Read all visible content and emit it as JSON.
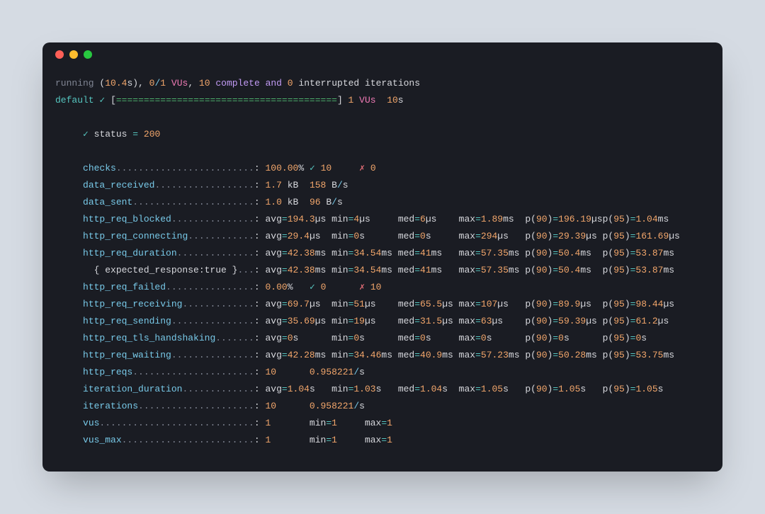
{
  "header": {
    "word_running": "running",
    "elapsed": "10.4",
    "vus_cur": "0",
    "vus_max": "1",
    "word_VUs": "VUs",
    "iters_done": "10",
    "word_complete": "complete",
    "word_and": "and",
    "interrupted": "0",
    "tail": " interrupted iterations"
  },
  "progress": {
    "label_default": "default",
    "check": "✓",
    "bar": "========================================",
    "vus_num": "1",
    "vus_word": "VUs",
    "dur": "10",
    "dur_unit": "s"
  },
  "status_check": {
    "mark": "✓",
    "text": "status",
    "eq": "=",
    "code": "200"
  },
  "metrics": {
    "checks": {
      "name": "checks",
      "dots": ".........................",
      "pct": "100.00",
      "pct_sym": "%",
      "check_n": "10",
      "fail_n": "0"
    },
    "data_received": {
      "name": "data_received",
      "dots": "..................",
      "val": "1.7",
      "unit": "kB",
      "rate": "158",
      "rate_unit_pre": "B",
      "rate_slash": "/",
      "rate_unit_post": "s"
    },
    "data_sent": {
      "name": "data_sent",
      "dots": "......................",
      "val": "1.0",
      "unit": "kB",
      "rate": "96",
      "rate_unit_pre": "B",
      "rate_slash": "/",
      "rate_unit_post": "s"
    },
    "http_req_blocked": {
      "name": "http_req_blocked",
      "dots": "...............",
      "avg": "194.3µs",
      "min": "4µs",
      "med": "6µs",
      "max": "1.89ms",
      "p90": "196.19µs",
      "p95": "1.04ms"
    },
    "http_req_connecting": {
      "name": "http_req_connecting",
      "dots": "............",
      "avg": "29.4µs",
      "min": "0s",
      "med": "0s",
      "max": "294µs",
      "p90": "29.39µs",
      "p95": "161.69µs"
    },
    "http_req_duration": {
      "name": "http_req_duration",
      "dots": "..............",
      "avg": "42.38ms",
      "min": "34.54ms",
      "med": "41ms",
      "max": "57.35ms",
      "p90": "50.4ms",
      "p95": "53.87ms"
    },
    "expected_response": {
      "label": "{ expected_response:true }",
      "dots": "...",
      "avg": "42.38ms",
      "min": "34.54ms",
      "med": "41ms",
      "max": "57.35ms",
      "p90": "50.4ms",
      "p95": "53.87ms"
    },
    "http_req_failed": {
      "name": "http_req_failed",
      "dots": "................",
      "pct": "0.00",
      "pct_sym": "%",
      "check_n": "0",
      "fail_n": "10"
    },
    "http_req_receiving": {
      "name": "http_req_receiving",
      "dots": ".............",
      "avg": "69.7µs",
      "min": "51µs",
      "med": "65.5µs",
      "max": "107µs",
      "p90": "89.9µs",
      "p95": "98.44µs"
    },
    "http_req_sending": {
      "name": "http_req_sending",
      "dots": "...............",
      "avg": "35.69µs",
      "min": "19µs",
      "med": "31.5µs",
      "max": "63µs",
      "p90": "59.39µs",
      "p95": "61.2µs"
    },
    "http_req_tls_handshaking": {
      "name": "http_req_tls_handshaking",
      "dots": ".......",
      "avg": "0s",
      "min": "0s",
      "med": "0s",
      "max": "0s",
      "p90": "0s",
      "p95": "0s"
    },
    "http_req_waiting": {
      "name": "http_req_waiting",
      "dots": "...............",
      "avg": "42.28ms",
      "min": "34.46ms",
      "med": "40.9ms",
      "max": "57.23ms",
      "p90": "50.28ms",
      "p95": "53.75ms"
    },
    "http_reqs": {
      "name": "http_reqs",
      "dots": "......................",
      "count": "10",
      "rate": "0.958221",
      "slash": "/",
      "rate_unit": "s"
    },
    "iteration_duration": {
      "name": "iteration_duration",
      "dots": ".............",
      "avg": "1.04s",
      "min": "1.03s",
      "med": "1.04s",
      "max": "1.05s",
      "p90": "1.05s",
      "p95": "1.05s"
    },
    "iterations": {
      "name": "iterations",
      "dots": ".....................",
      "count": "10",
      "rate": "0.958221",
      "slash": "/",
      "rate_unit": "s"
    },
    "vus": {
      "name": "vus",
      "dots": "............................",
      "val": "1",
      "min": "1",
      "max": "1"
    },
    "vus_max": {
      "name": "vus_max",
      "dots": "........................",
      "val": "1",
      "min": "1",
      "max": "1"
    }
  },
  "labels": {
    "avg": "avg",
    "min": "min",
    "med": "med",
    "max": "max",
    "p90_open": "p(",
    "p90_n": "90",
    "p90_close": ")",
    "p95_open": "p(",
    "p95_n": "95",
    "p95_close": ")",
    "eq": "=",
    "colon": ":",
    "check": "✓",
    "cross": "✗"
  }
}
